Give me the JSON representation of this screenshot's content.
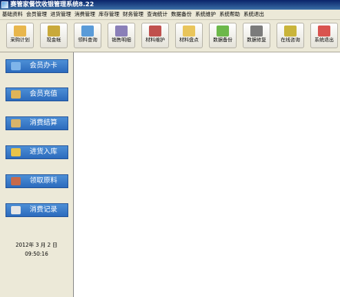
{
  "window": {
    "title": "赛管家餐饮收银管理系统8.22"
  },
  "menu": [
    "基础资料",
    "会员管理",
    "进货管理",
    "消费管理",
    "库存管理",
    "财务管理",
    "查询统计",
    "数据备份",
    "系统维护",
    "系统帮助",
    "系统退出"
  ],
  "toolbar": [
    {
      "label": "采购计划",
      "icon": "book-icon",
      "color": "#e8b64c"
    },
    {
      "label": "现金帐",
      "icon": "cash-icon",
      "color": "#c9a93a"
    },
    {
      "label": "领料查询",
      "icon": "brush-icon",
      "color": "#5a9bd8"
    },
    {
      "label": "销售明细",
      "icon": "house-icon",
      "color": "#8a7fb8"
    },
    {
      "label": "材料维护",
      "icon": "books-icon",
      "color": "#c0504d"
    },
    {
      "label": "材料盘点",
      "icon": "folder-icon",
      "color": "#e9c55b"
    },
    {
      "label": "数据备份",
      "icon": "globe-icon",
      "color": "#6cb84a"
    },
    {
      "label": "数据修复",
      "icon": "disk-icon",
      "color": "#7b7b7b"
    },
    {
      "label": "在线咨询",
      "icon": "help-icon",
      "color": "#c9b43a"
    },
    {
      "label": "系统退出",
      "icon": "power-icon",
      "color": "#d9534f"
    }
  ],
  "sidebar": [
    {
      "label": "会员办卡",
      "icon": "card-icon",
      "color": "#7fb5ea"
    },
    {
      "label": "会员充值",
      "icon": "recharge-icon",
      "color": "#e0b458"
    },
    {
      "label": "消费结算",
      "icon": "checkout-icon",
      "color": "#d8b46a"
    },
    {
      "label": "进货入库",
      "icon": "stock-in-icon",
      "color": "#e8c34a"
    },
    {
      "label": "领取原料",
      "icon": "materials-icon",
      "color": "#c86a4a"
    },
    {
      "label": "消费记录",
      "icon": "records-icon",
      "color": "#e6e6e6"
    }
  ],
  "date": {
    "line1": "2012年   3 月 2  日",
    "line2": "09:50:16"
  }
}
